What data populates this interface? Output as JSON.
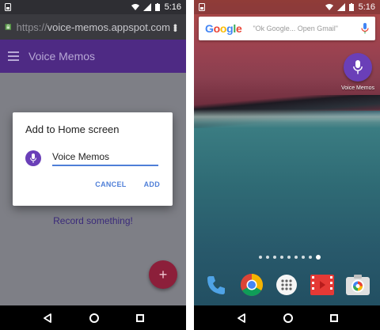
{
  "left_phone": {
    "status_bar": {
      "time": "5:16"
    },
    "browser": {
      "url_scheme": "https://",
      "url_host": "voice-memos.appspot.com"
    },
    "app_bar": {
      "title": "Voice Memos"
    },
    "content": {
      "record_prompt": "Record something!"
    },
    "fab": {
      "label": "+"
    },
    "dialog": {
      "title": "Add to Home screen",
      "name_value": "Voice Memos",
      "cancel_label": "CANCEL",
      "add_label": "ADD"
    }
  },
  "right_phone": {
    "status_bar": {
      "time": "5:16"
    },
    "search_bar": {
      "logo_text": "Google",
      "hint": "\"Ok Google... Open Gmail\""
    },
    "shortcut": {
      "label": "Voice Memos",
      "icon": "mic-icon"
    },
    "page_indicator": {
      "count": 9,
      "active_index": 8
    },
    "dock": [
      {
        "icon": "phone-icon"
      },
      {
        "icon": "chrome-icon"
      },
      {
        "icon": "app-drawer-icon"
      },
      {
        "icon": "play-movies-icon"
      },
      {
        "icon": "camera-icon"
      }
    ]
  },
  "colors": {
    "accent_purple": "#6a3fb8",
    "app_bar": "#4e2a84",
    "dialog_accent": "#4f7fd8",
    "fab": "#8c1f3a"
  }
}
